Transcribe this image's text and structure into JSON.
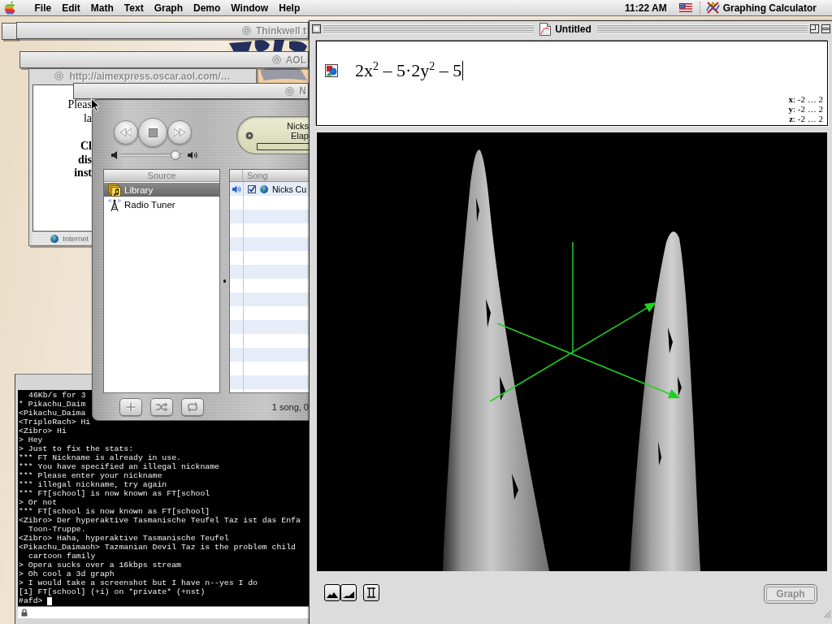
{
  "menu_bar": {
    "menus": [
      "File",
      "Edit",
      "Math",
      "Text",
      "Graph",
      "Demo",
      "Window",
      "Help"
    ],
    "clock": "11:22 AM",
    "app_menu": "Graphing Calculator"
  },
  "shaded_windows": [
    {
      "title": "Thinkwell t"
    },
    {
      "title": "AOL"
    },
    {
      "title": "N"
    }
  ],
  "browser_window": {
    "title": "http://aimexpress.oscar.aol.com/…",
    "paragraphs": [
      {
        "bold": false,
        "lines": [
          "Pleas",
          "la"
        ]
      },
      {
        "bold": true,
        "lines": [
          "Cl",
          "dis",
          "inst"
        ]
      }
    ],
    "status": "Internet"
  },
  "itunes": {
    "volume": {
      "level": 0.95
    },
    "display": {
      "lines": [
        "Nicks",
        "Elap"
      ]
    },
    "source_header": "Source",
    "sources": [
      {
        "kind": "library",
        "label": "Library",
        "selected": true
      },
      {
        "kind": "radio",
        "label": "Radio Tuner",
        "selected": false
      }
    ],
    "song_header": "Song",
    "songs": [
      {
        "title": "Nicks Cu",
        "playing": true,
        "checked": true
      }
    ],
    "status": "1 song, 0"
  },
  "terminal": {
    "lines": [
      {
        "kind": "continuation",
        "text": "46Kb/s for 3"
      },
      {
        "kind": "line",
        "text": "* Pikachu_Daim"
      },
      {
        "kind": "line",
        "text": "<Pikachu_Daima"
      },
      {
        "kind": "line",
        "text": "<TripleRach> Hi"
      },
      {
        "kind": "line",
        "text": "<Zibro> Hi"
      },
      {
        "kind": "line",
        "text": "> Hey"
      },
      {
        "kind": "line",
        "text": "> Just to fix the stats:"
      },
      {
        "kind": "line",
        "text": "*** FT Nickname is already in use."
      },
      {
        "kind": "line",
        "text": "*** You have specified an illegal nickname"
      },
      {
        "kind": "line",
        "text": "*** Please enter your nickname"
      },
      {
        "kind": "line",
        "text": "*** illegal nickname, try again"
      },
      {
        "kind": "line",
        "text": "*** FT[school] is now known as FT[school"
      },
      {
        "kind": "line",
        "text": "> Or not"
      },
      {
        "kind": "line",
        "text": "*** FT[school is now known as FT[school]"
      },
      {
        "kind": "line",
        "text": "<Zibro> Der hyperaktive Tasmanische Teufel Taz ist das Enfa"
      },
      {
        "kind": "continuation",
        "text": "Toon-Truppe."
      },
      {
        "kind": "line",
        "text": "<Zibro> Haha, hyperaktive Tasmanische Teufel"
      },
      {
        "kind": "line",
        "text": "<Pikachu_Daimaoh> Tazmanian Devil Taz is the problem child"
      },
      {
        "kind": "continuation",
        "text": "cartoon family"
      },
      {
        "kind": "line",
        "text": "> Opera sucks over a 16kbps stream"
      },
      {
        "kind": "line",
        "text": "> Oh cool a 3d graph"
      },
      {
        "kind": "line",
        "text": "> I would take a screenshot but I have n--yes I do"
      },
      {
        "kind": "line",
        "text": "[1] FT[school] (+i) on *private* (+nst)"
      }
    ],
    "prompt": "#afd>"
  },
  "graph_window": {
    "title": "Untitled",
    "equation": "2x$^{2}$ – 5·2y$^{2}$ – 5",
    "ranges": [
      "**x**: -2 … 2",
      "**y**: -2 … 2",
      "**z**: -2 … 2"
    ],
    "graph_button": {
      "label": "Graph",
      "disabled": true
    }
  }
}
